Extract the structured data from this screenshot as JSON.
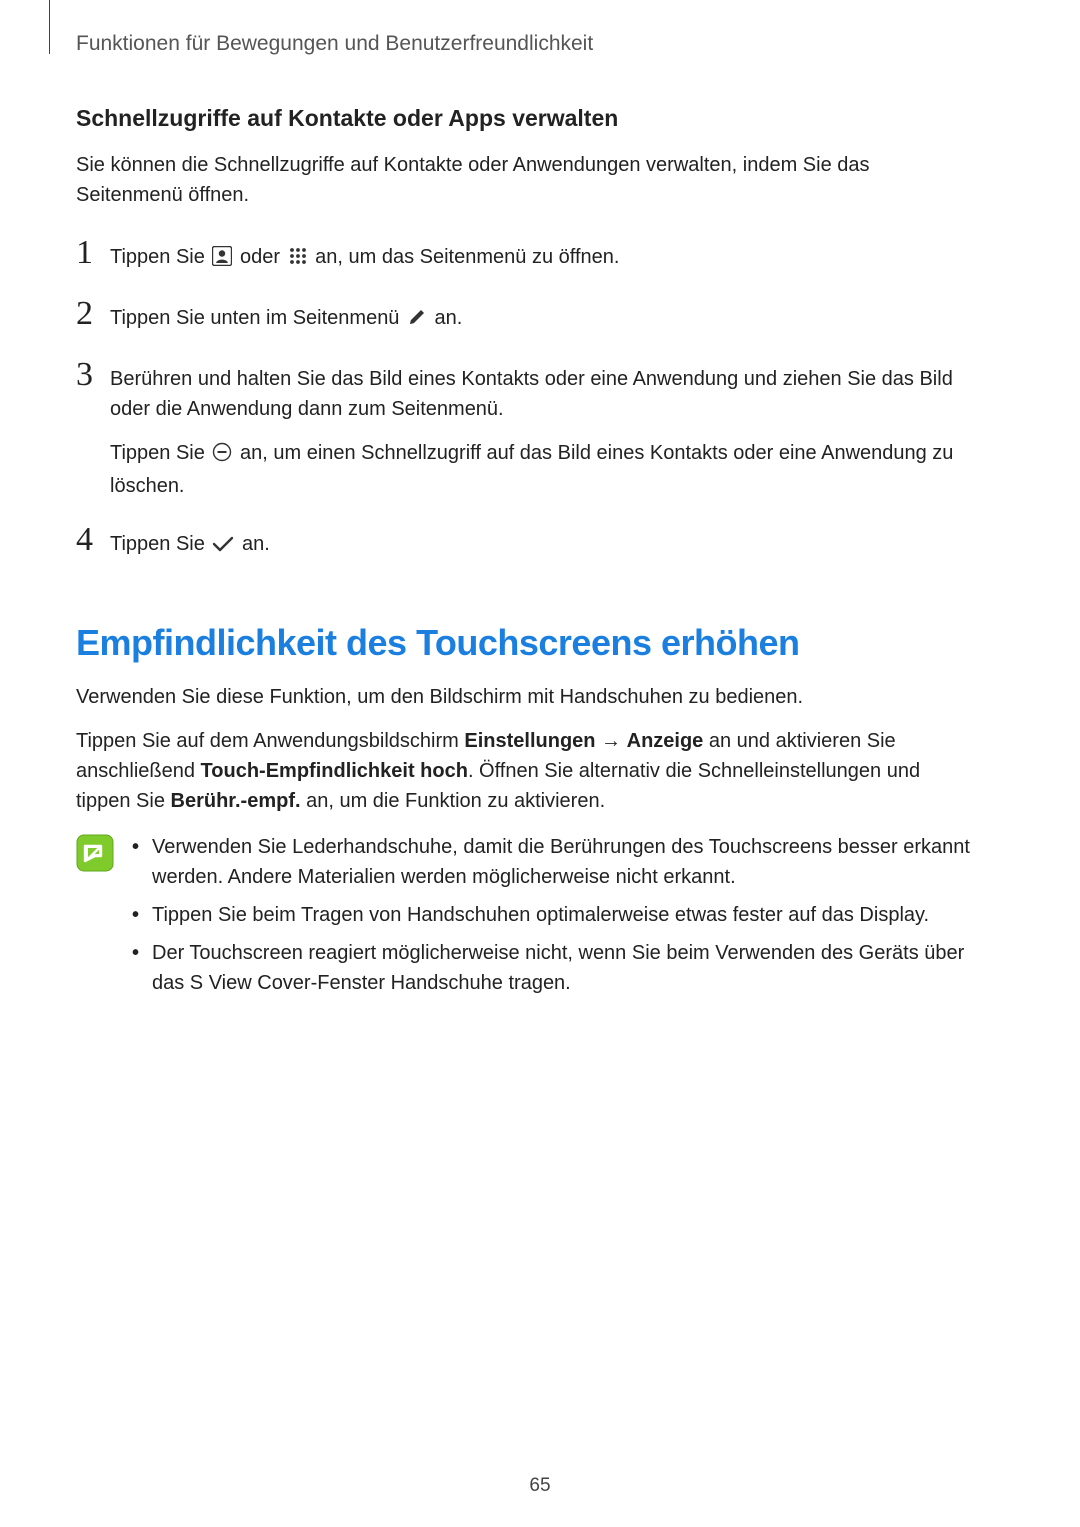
{
  "chapter_title": "Funktionen für Bewegungen und Benutzerfreundlichkeit",
  "subheading": "Schnellzugriffe auf Kontakte oder Apps verwalten",
  "intro": "Sie können die Schnellzugriffe auf Kontakte oder Anwendungen verwalten, indem Sie das Seitenmenü öffnen.",
  "steps": {
    "s1": {
      "num": "1",
      "p1a": "Tippen Sie ",
      "p1b": " oder ",
      "p1c": " an, um das Seitenmenü zu öffnen."
    },
    "s2": {
      "num": "2",
      "p1a": "Tippen Sie unten im Seitenmenü ",
      "p1b": " an."
    },
    "s3": {
      "num": "3",
      "p1": "Berühren und halten Sie das Bild eines Kontakts oder eine Anwendung und ziehen Sie das Bild oder die Anwendung dann zum Seitenmenü.",
      "p2a": "Tippen Sie ",
      "p2b": " an, um einen Schnellzugriff auf das Bild eines Kontakts oder eine Anwendung zu löschen."
    },
    "s4": {
      "num": "4",
      "p1a": "Tippen Sie ",
      "p1b": " an."
    }
  },
  "section_title": "Empfindlichkeit des Touchscreens erhöhen",
  "body1": "Verwenden Sie diese Funktion, um den Bildschirm mit Handschuhen zu bedienen.",
  "body2_a": "Tippen Sie auf dem Anwendungsbildschirm ",
  "body2_b1": "Einstellungen",
  "body2_arrow": " → ",
  "body2_b2": "Anzeige",
  "body2_c": " an und aktivieren Sie anschließend ",
  "body2_b3": "Touch-Empfindlichkeit hoch",
  "body2_d": ". Öffnen Sie alternativ die Schnelleinstellungen und tippen Sie ",
  "body2_b4": "Berühr.-empf.",
  "body2_e": " an, um die Funktion zu aktivieren.",
  "notes": {
    "n0": "Verwenden Sie Lederhandschuhe, damit die Berührungen des Touchscreens besser erkannt werden. Andere Materialien werden möglicherweise nicht erkannt.",
    "n1": "Tippen Sie beim Tragen von Handschuhen optimalerweise etwas fester auf das Display.",
    "n2": "Der Touchscreen reagiert möglicherweise nicht, wenn Sie beim Verwenden des Geräts über das S View Cover-Fenster Handschuhe tragen."
  },
  "bullet": "•",
  "page_number": "65"
}
